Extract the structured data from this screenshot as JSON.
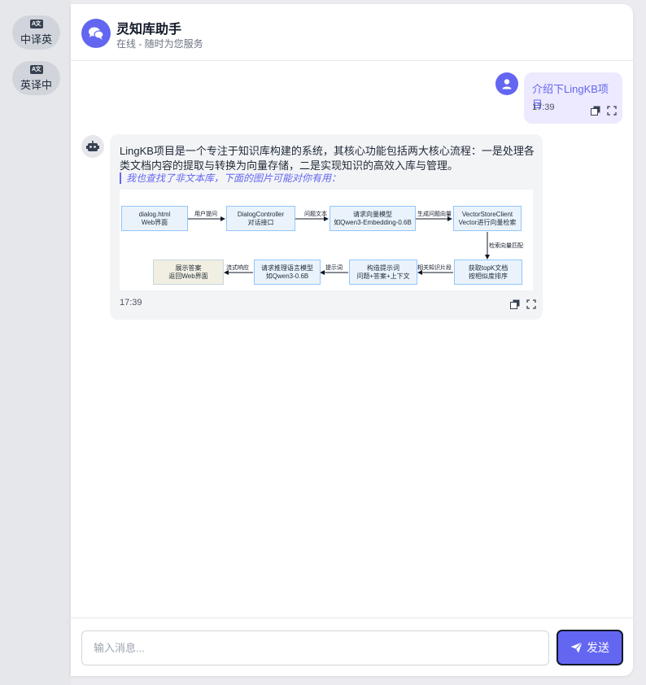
{
  "sidebar": {
    "items": [
      {
        "label": "中译英",
        "icon": "translate-icon"
      },
      {
        "label": "英译中",
        "icon": "translate-icon"
      }
    ]
  },
  "header": {
    "title": "灵知库助手",
    "subtitle": "在线 - 随时为您服务"
  },
  "messages": {
    "user": {
      "text": "介绍下LingKB项目",
      "time": "17:39"
    },
    "bot": {
      "text": "LingKB项目是一个专注于知识库构建的系统，其核心功能包括两大核心流程：一是处理各类文档内容的提取与转换为向量存储，二是实现知识的高效入库与管理。",
      "note": "我也查找了非文本库，下面的图片可能对你有用：",
      "time": "17:39"
    }
  },
  "diagram": {
    "nodes": {
      "n1": [
        "dialog.html",
        "Web界面"
      ],
      "n2": [
        "DialogController",
        "对话接口"
      ],
      "n3": [
        "请求向量模型",
        "如Qwen3-Embedding-0.6B"
      ],
      "n4": [
        "VectorStoreClient",
        "Vector进行向量检索"
      ],
      "n5": [
        "获取topK文档",
        "按相似度排序"
      ],
      "n6": [
        "构造提示词",
        "问题+答案+上下文"
      ],
      "n7": [
        "请求推理语言模型",
        "如Qwen3-0.6B"
      ],
      "n8": [
        "展示答案",
        "返回Web界面"
      ]
    },
    "edges": {
      "e1": "用户提问",
      "e2": "问题文本",
      "e3": "生成问题向量",
      "e4": "检索向量匹配",
      "e5": "相关知识片段",
      "e6": "提示词",
      "e7": "流式响应"
    }
  },
  "input": {
    "placeholder": "输入消息...",
    "value": ""
  },
  "send_button": {
    "label": "发送"
  },
  "colors": {
    "accent": "#6366f1",
    "user_bubble": "#ede9fe",
    "bot_bubble": "#f3f4f6"
  }
}
